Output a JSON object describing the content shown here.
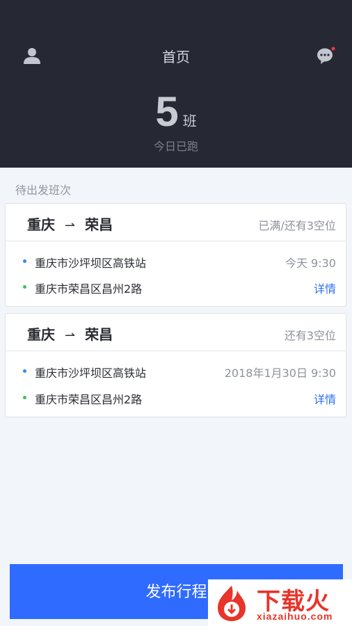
{
  "header": {
    "title": "首页",
    "user_icon": "user-icon",
    "message_icon": "message-icon",
    "badge_color": "#e23b3b"
  },
  "stats": {
    "count": "5",
    "unit": "班",
    "label": "今日已跑"
  },
  "section_title": "待出发班次",
  "trips": [
    {
      "from": "重庆",
      "arrow": "⇀",
      "to": "荣昌",
      "seats": "已满/还有3空位",
      "start_place": "重庆市沙坪坝区高铁站",
      "time": "今天 9:30",
      "end_place": "重庆市荣昌区昌州2路",
      "detail": "详情"
    },
    {
      "from": "重庆",
      "arrow": "⇀",
      "to": "荣昌",
      "seats": "还有3空位",
      "start_place": "重庆市沙坪坝区高铁站",
      "time": "2018年1月30日 9:30",
      "end_place": "重庆市荣昌区昌州2路",
      "detail": "详情"
    }
  ],
  "publish_button": "发布行程",
  "watermark": {
    "main": "下载火",
    "url": "xiazaihuo.com",
    "color": "#e8342a"
  }
}
